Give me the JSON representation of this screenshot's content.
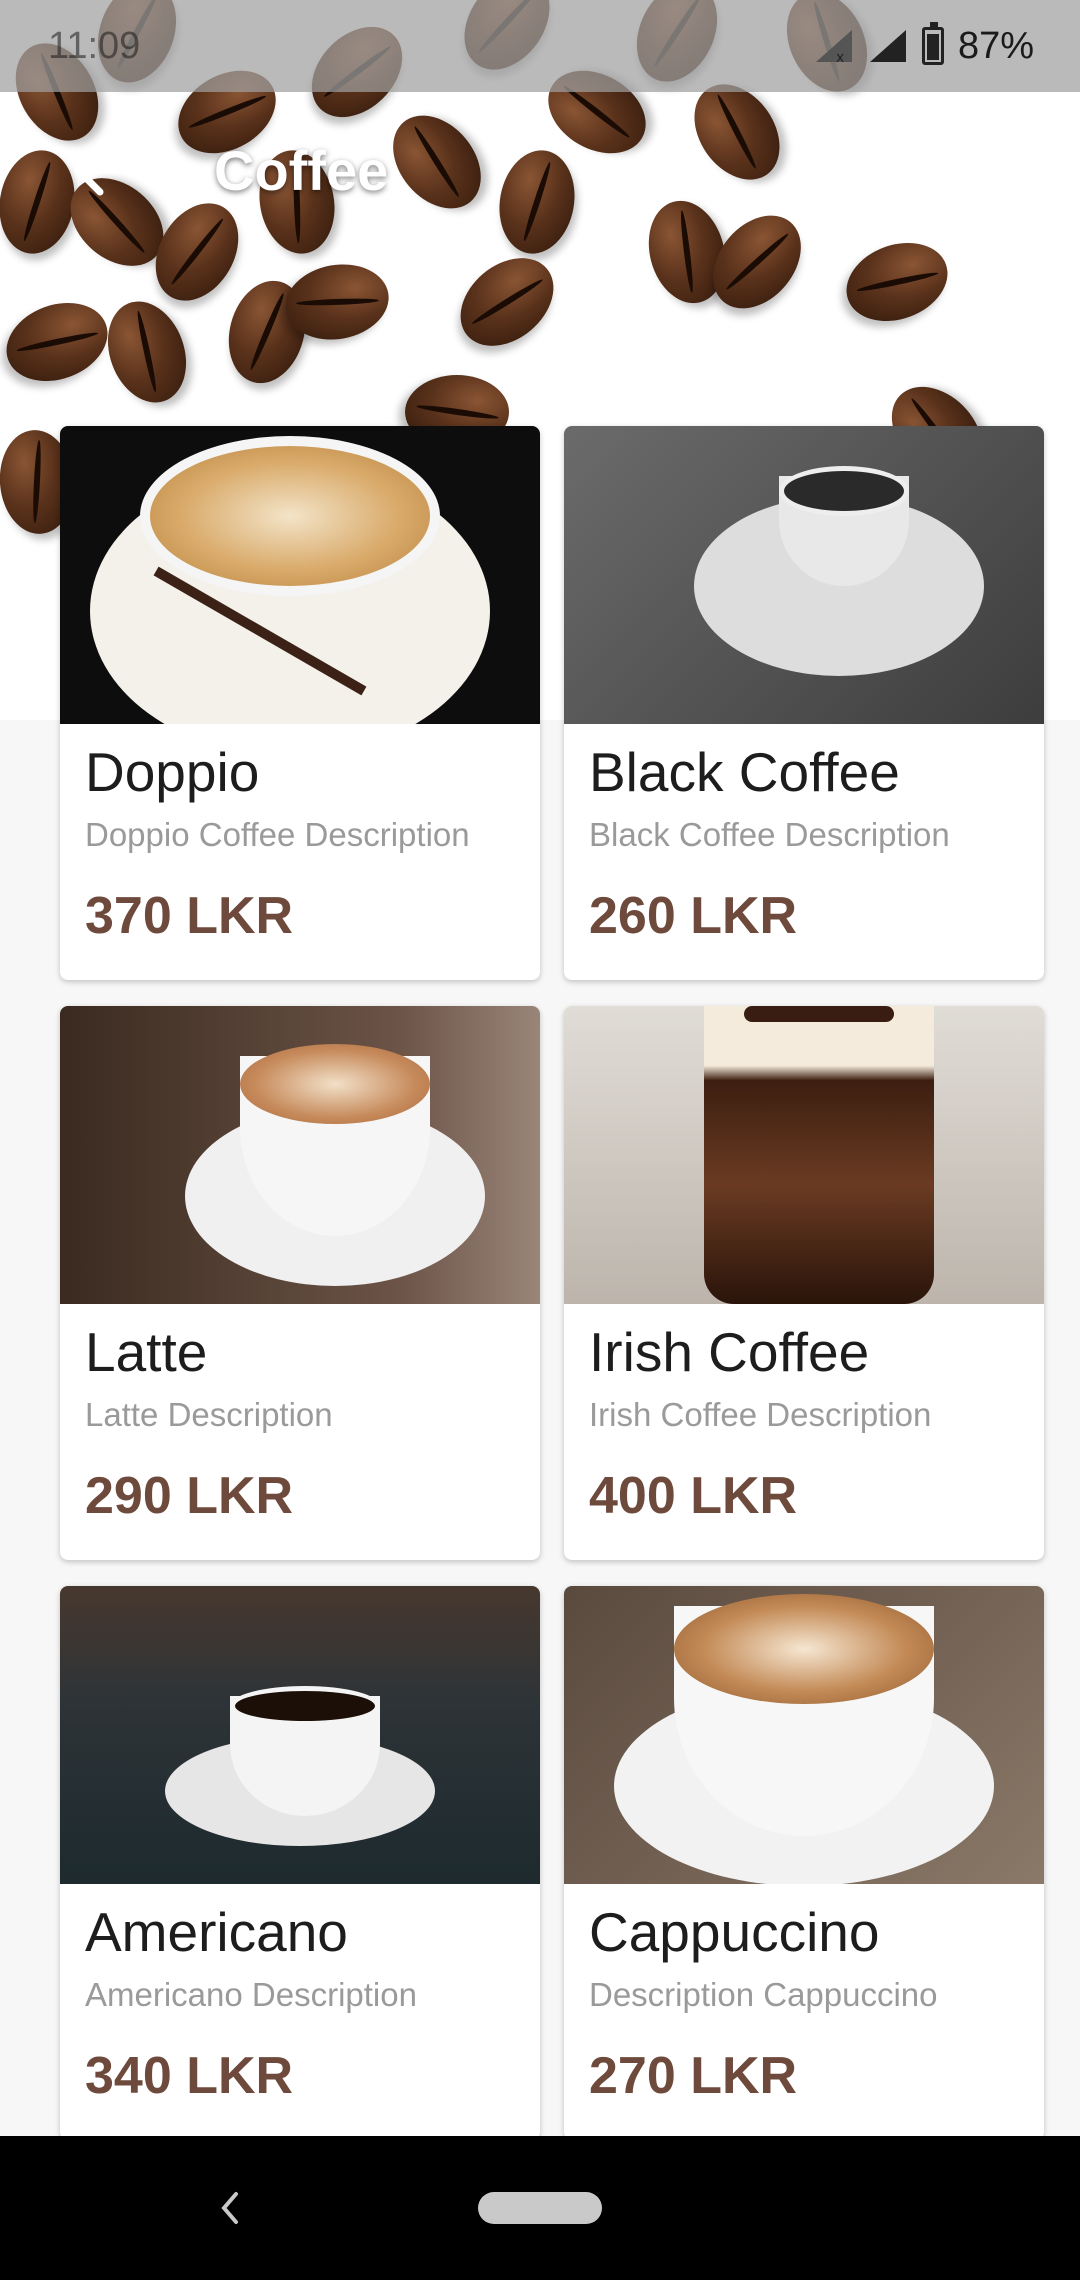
{
  "status_bar": {
    "time": "11:09",
    "battery": "87%"
  },
  "app_bar": {
    "title": "Coffee",
    "back_icon": "arrow-back-icon"
  },
  "products": [
    {
      "name": "Doppio",
      "description": "Doppio Coffee Description",
      "price": "370 LKR"
    },
    {
      "name": "Black Coffee",
      "description": "Black Coffee Description",
      "price": "260 LKR"
    },
    {
      "name": "Latte",
      "description": "Latte Description",
      "price": "290 LKR"
    },
    {
      "name": "Irish Coffee",
      "description": "Irish Coffee Description",
      "price": "400 LKR"
    },
    {
      "name": "Americano",
      "description": "Americano Description",
      "price": "340 LKR"
    },
    {
      "name": "Cappuccino",
      "description": "Description Cappuccino",
      "price": "270 LKR"
    }
  ],
  "colors": {
    "price": "#6e4a3c",
    "title": "#ffffff",
    "status_bar": "#a0a0a0"
  },
  "nav": {
    "back_icon": "chevron-left-icon",
    "home_icon": "home-pill-icon"
  }
}
